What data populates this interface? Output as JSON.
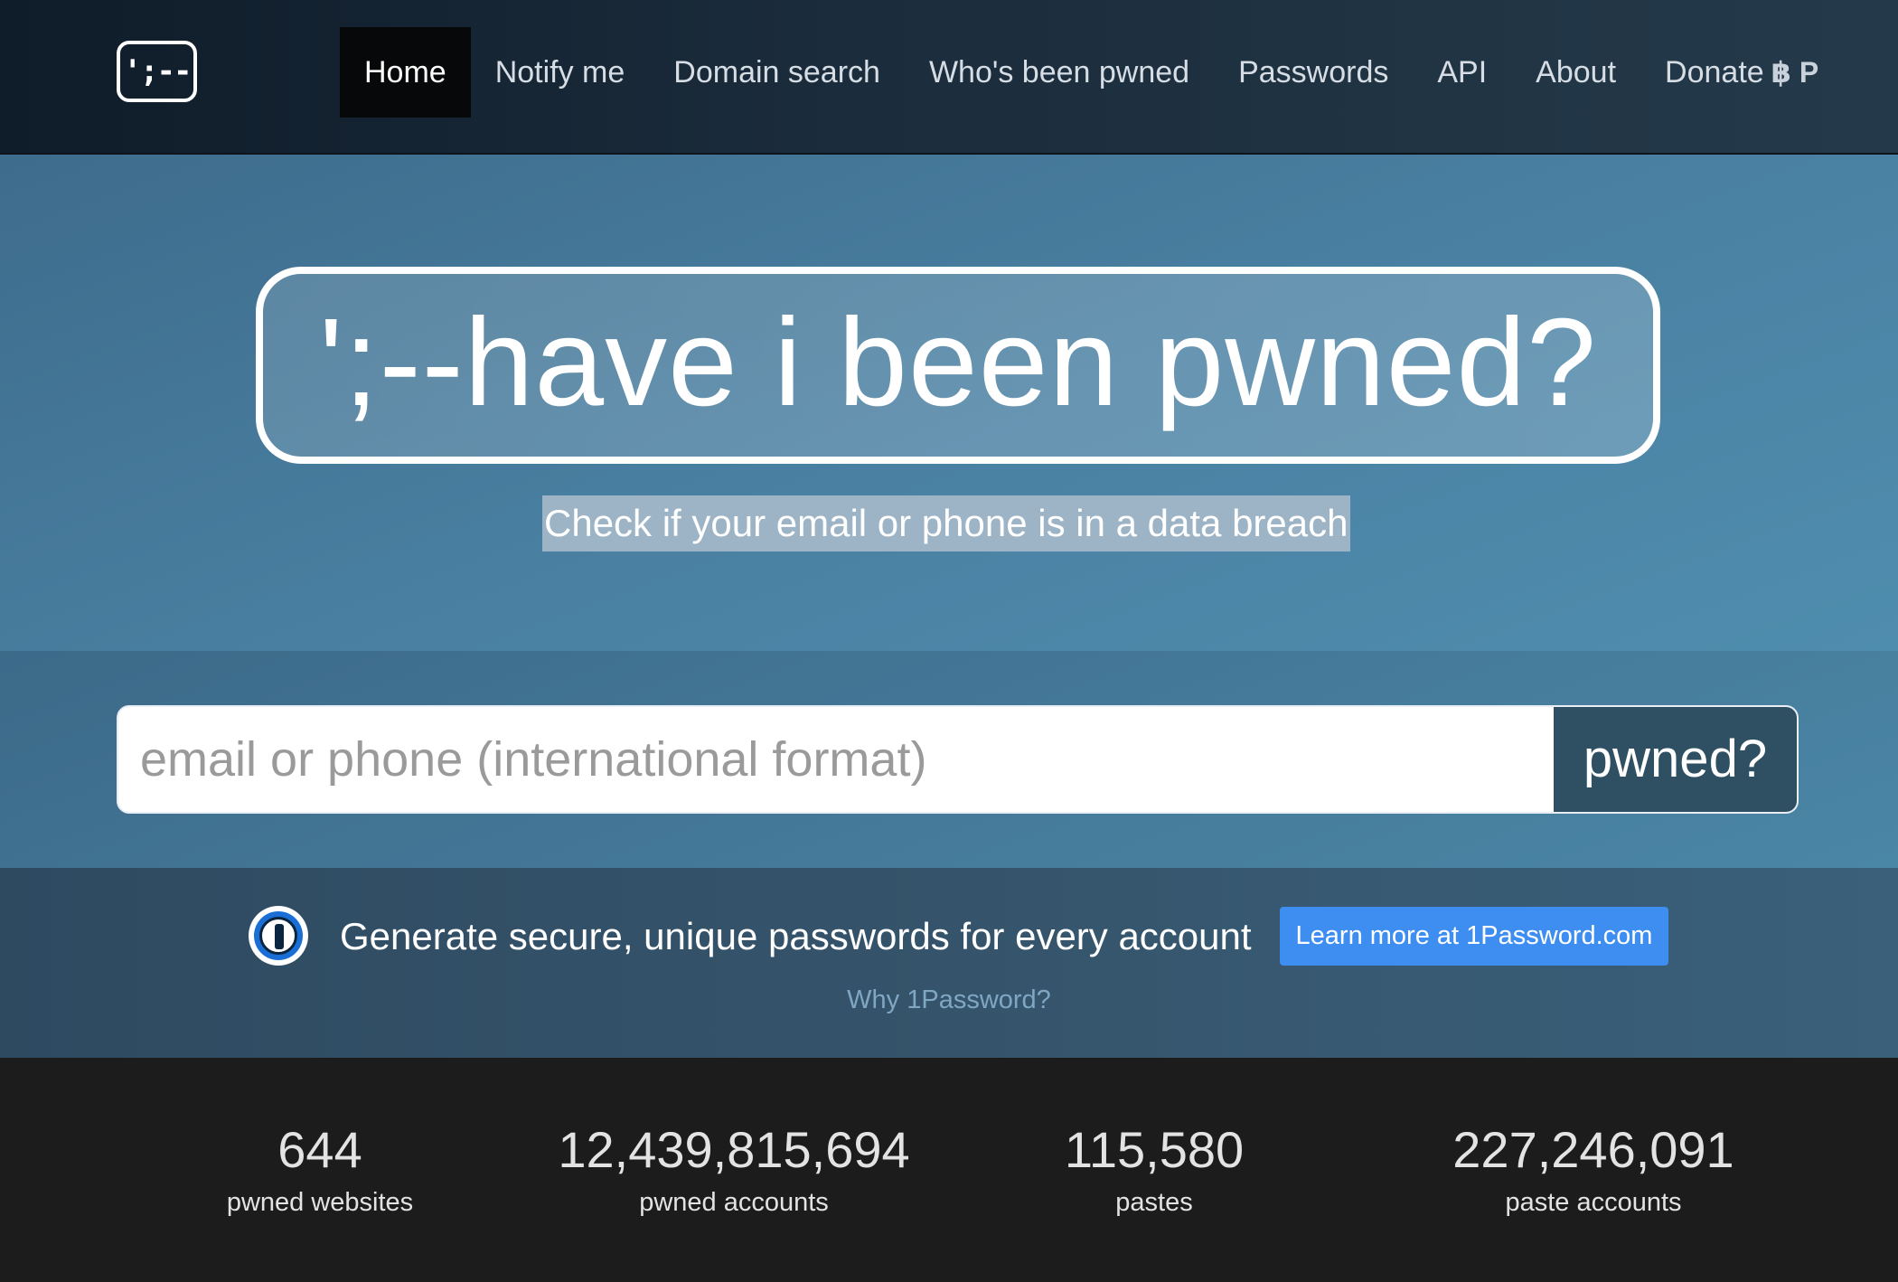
{
  "logo": {
    "text": "';--"
  },
  "nav": {
    "items": [
      {
        "label": "Home",
        "active": true
      },
      {
        "label": "Notify me"
      },
      {
        "label": "Domain search"
      },
      {
        "label": "Who's been pwned"
      },
      {
        "label": "Passwords"
      },
      {
        "label": "API"
      },
      {
        "label": "About"
      },
      {
        "label": "Donate",
        "icons": "฿ P"
      }
    ]
  },
  "hero": {
    "title": "';--have i been pwned?",
    "tagline": "Check if your email or phone is in a data breach"
  },
  "search": {
    "placeholder": "email or phone (international format)",
    "value": "",
    "button_label": "pwned?"
  },
  "promo": {
    "icon": "1password-icon",
    "text": "Generate secure, unique passwords for every account",
    "button_label": "Learn more at 1Password.com",
    "link_label": "Why 1Password?"
  },
  "stats": [
    {
      "value": "644",
      "label": "pwned websites"
    },
    {
      "value": "12,439,815,694",
      "label": "pwned accounts"
    },
    {
      "value": "115,580",
      "label": "pastes"
    },
    {
      "value": "227,246,091",
      "label": "paste accounts"
    }
  ],
  "colors": {
    "nav_bg": "#1b2c3c",
    "hero_bg": "#4a81a3",
    "search_button": "#2f4f62",
    "promo_button": "#3d8ef0",
    "stats_bg": "#1c1c1c"
  }
}
